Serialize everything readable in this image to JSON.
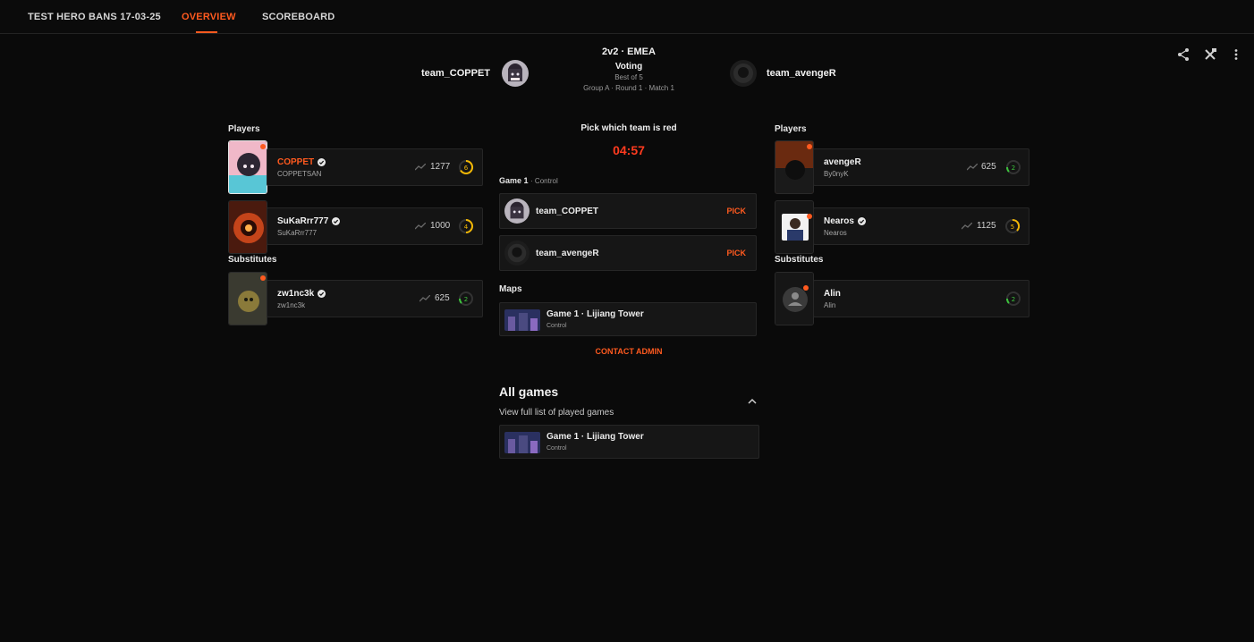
{
  "tabs": [
    {
      "label": "TEST HERO BANS 17-03-25"
    },
    {
      "label": "OVERVIEW"
    },
    {
      "label": "SCOREBOARD"
    }
  ],
  "accent_color": "#ff5a1f",
  "match": {
    "format": "2v2 · EMEA",
    "status": "Voting",
    "best_of": "Best of 5",
    "group_round": "Group A · Round 1 · Match 1",
    "team_left": "team_COPPET",
    "team_right": "team_avengeR"
  },
  "toolbar_icons": [
    "share-icon",
    "tools-icon",
    "more-vertical-icon"
  ],
  "left": {
    "players_title": "Players",
    "subs_title": "Substitutes",
    "players": [
      {
        "name": "COPPET",
        "handle": "COPPETSAN",
        "rating": "1277",
        "level": "6",
        "highlight": true
      },
      {
        "name": "SuKaRrr777",
        "handle": "SuKaRrr777",
        "rating": "1000",
        "level": "4",
        "highlight": false
      }
    ],
    "subs": [
      {
        "name": "zw1nc3k",
        "handle": "zw1nc3k",
        "rating": "625",
        "level": "2"
      }
    ]
  },
  "right": {
    "players_title": "Players",
    "subs_title": "Substitutes",
    "players": [
      {
        "name": "avengeR",
        "handle": "By0nyK",
        "rating": "625",
        "level": "2"
      },
      {
        "name": "Nearos",
        "handle": "Nearos",
        "rating": "1125",
        "level": "5"
      }
    ],
    "subs": [
      {
        "name": "Alin",
        "handle": "Alin",
        "level": "2"
      }
    ]
  },
  "veto": {
    "title": "Pick which team is red",
    "timer": "04:57",
    "game_label": "Game 1",
    "game_mode": "· Control",
    "options": [
      {
        "team": "team_COPPET",
        "button": "PICK"
      },
      {
        "team": "team_avengeR",
        "button": "PICK"
      }
    ],
    "maps_title": "Maps",
    "map": {
      "title": "Game 1 · Lijiang Tower",
      "mode": "Control"
    },
    "contact_label": "CONTACT ADMIN"
  },
  "all_games": {
    "title": "All games",
    "subtitle": "View full list of played games",
    "games": [
      {
        "title": "Game 1 · Lijiang Tower",
        "mode": "Control"
      }
    ]
  }
}
